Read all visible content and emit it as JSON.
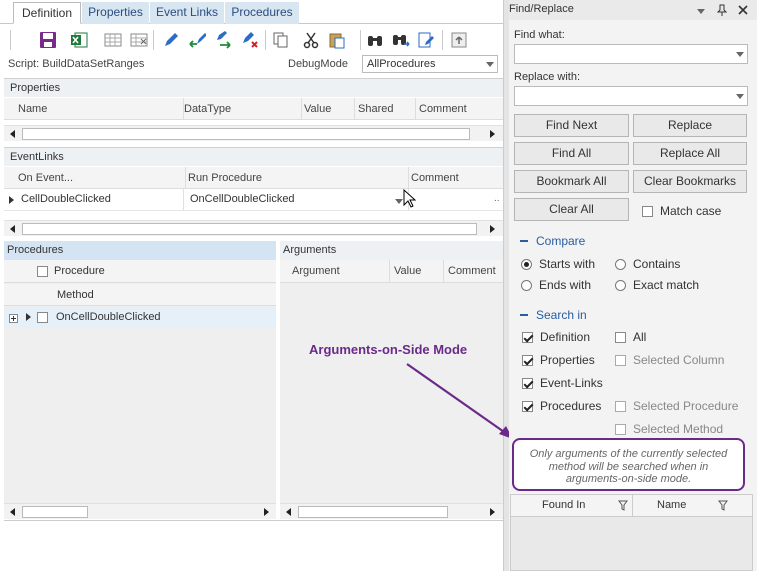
{
  "tabs": [
    {
      "label": "Definition",
      "active": true
    },
    {
      "label": "Properties",
      "active": false
    },
    {
      "label": "Event Links",
      "active": false
    },
    {
      "label": "Procedures",
      "active": false
    }
  ],
  "toolbar": {
    "icons": [
      "save-icon",
      "excel-export-icon",
      "grid-columns-icon",
      "grid-columns-remove-icon",
      "edit-pencil-icon",
      "arrow-left-icon",
      "arrow-right-icon",
      "delete-pencil-icon",
      "copy-icon",
      "cut-icon",
      "paste-icon",
      "binoculars-icon",
      "binoculars-replace-icon",
      "edit-document-icon",
      "upload-icon"
    ]
  },
  "script_label": "Script: BuildDataSetRanges",
  "debug": {
    "label": "DebugMode",
    "value": "AllProcedures"
  },
  "properties": {
    "title": "Properties",
    "columns": [
      "Name",
      "DataType",
      "Value",
      "Shared",
      "Comment"
    ]
  },
  "eventlinks": {
    "title": "EventLinks",
    "columns": [
      "On Event...",
      "Run Procedure",
      "Comment"
    ],
    "row": {
      "on_event": "CellDoubleClicked",
      "run_procedure": "OnCellDoubleClicked",
      "ellipsis": ".."
    }
  },
  "procedures": {
    "title": "Procedures",
    "col_procedure": "Procedure",
    "col_method": "Method",
    "row": "OnCellDoubleClicked"
  },
  "arguments": {
    "title": "Arguments",
    "columns": [
      "Argument",
      "Value",
      "Comment"
    ]
  },
  "callout": {
    "text": "Arguments-on-Side Mode"
  },
  "note": {
    "text": "Only arguments of the currently selected method will be searched when in arguments-on-side mode."
  },
  "find_replace": {
    "title": "Find/Replace",
    "find_what_label": "Find what:",
    "find_what_value": "",
    "replace_with_label": "Replace with:",
    "replace_with_value": "",
    "buttons": {
      "find_next": "Find Next",
      "replace": "Replace",
      "find_all": "Find All",
      "replace_all": "Replace All",
      "bookmark_all": "Bookmark All",
      "clear_bookmarks": "Clear Bookmarks",
      "clear_all": "Clear All"
    },
    "match_case": {
      "label": "Match case",
      "checked": false
    },
    "compare": {
      "title": "Compare",
      "starts_with": {
        "label": "Starts with",
        "selected": true
      },
      "contains": {
        "label": "Contains",
        "selected": false
      },
      "ends_with": {
        "label": "Ends with",
        "selected": false
      },
      "exact_match": {
        "label": "Exact match",
        "selected": false
      }
    },
    "search_in": {
      "title": "Search in",
      "definition": {
        "label": "Definition",
        "checked": true
      },
      "properties": {
        "label": "Properties",
        "checked": true
      },
      "event_links": {
        "label": "Event-Links",
        "checked": true
      },
      "procedures": {
        "label": "Procedures",
        "checked": true
      },
      "all": {
        "label": "All",
        "checked": false
      },
      "selected_column": {
        "label": "Selected Column",
        "checked": false
      },
      "selected_procedure": {
        "label": "Selected Procedure",
        "checked": false
      },
      "selected_method": {
        "label": "Selected Method",
        "checked": false
      }
    },
    "results": {
      "columns": [
        "Found In",
        "Name"
      ]
    }
  },
  "colors": {
    "accent": "#2a5d9e",
    "callout": "#6a2a8a",
    "tab_bg": "#d7e6f1",
    "selection": "#e6f0f8"
  }
}
